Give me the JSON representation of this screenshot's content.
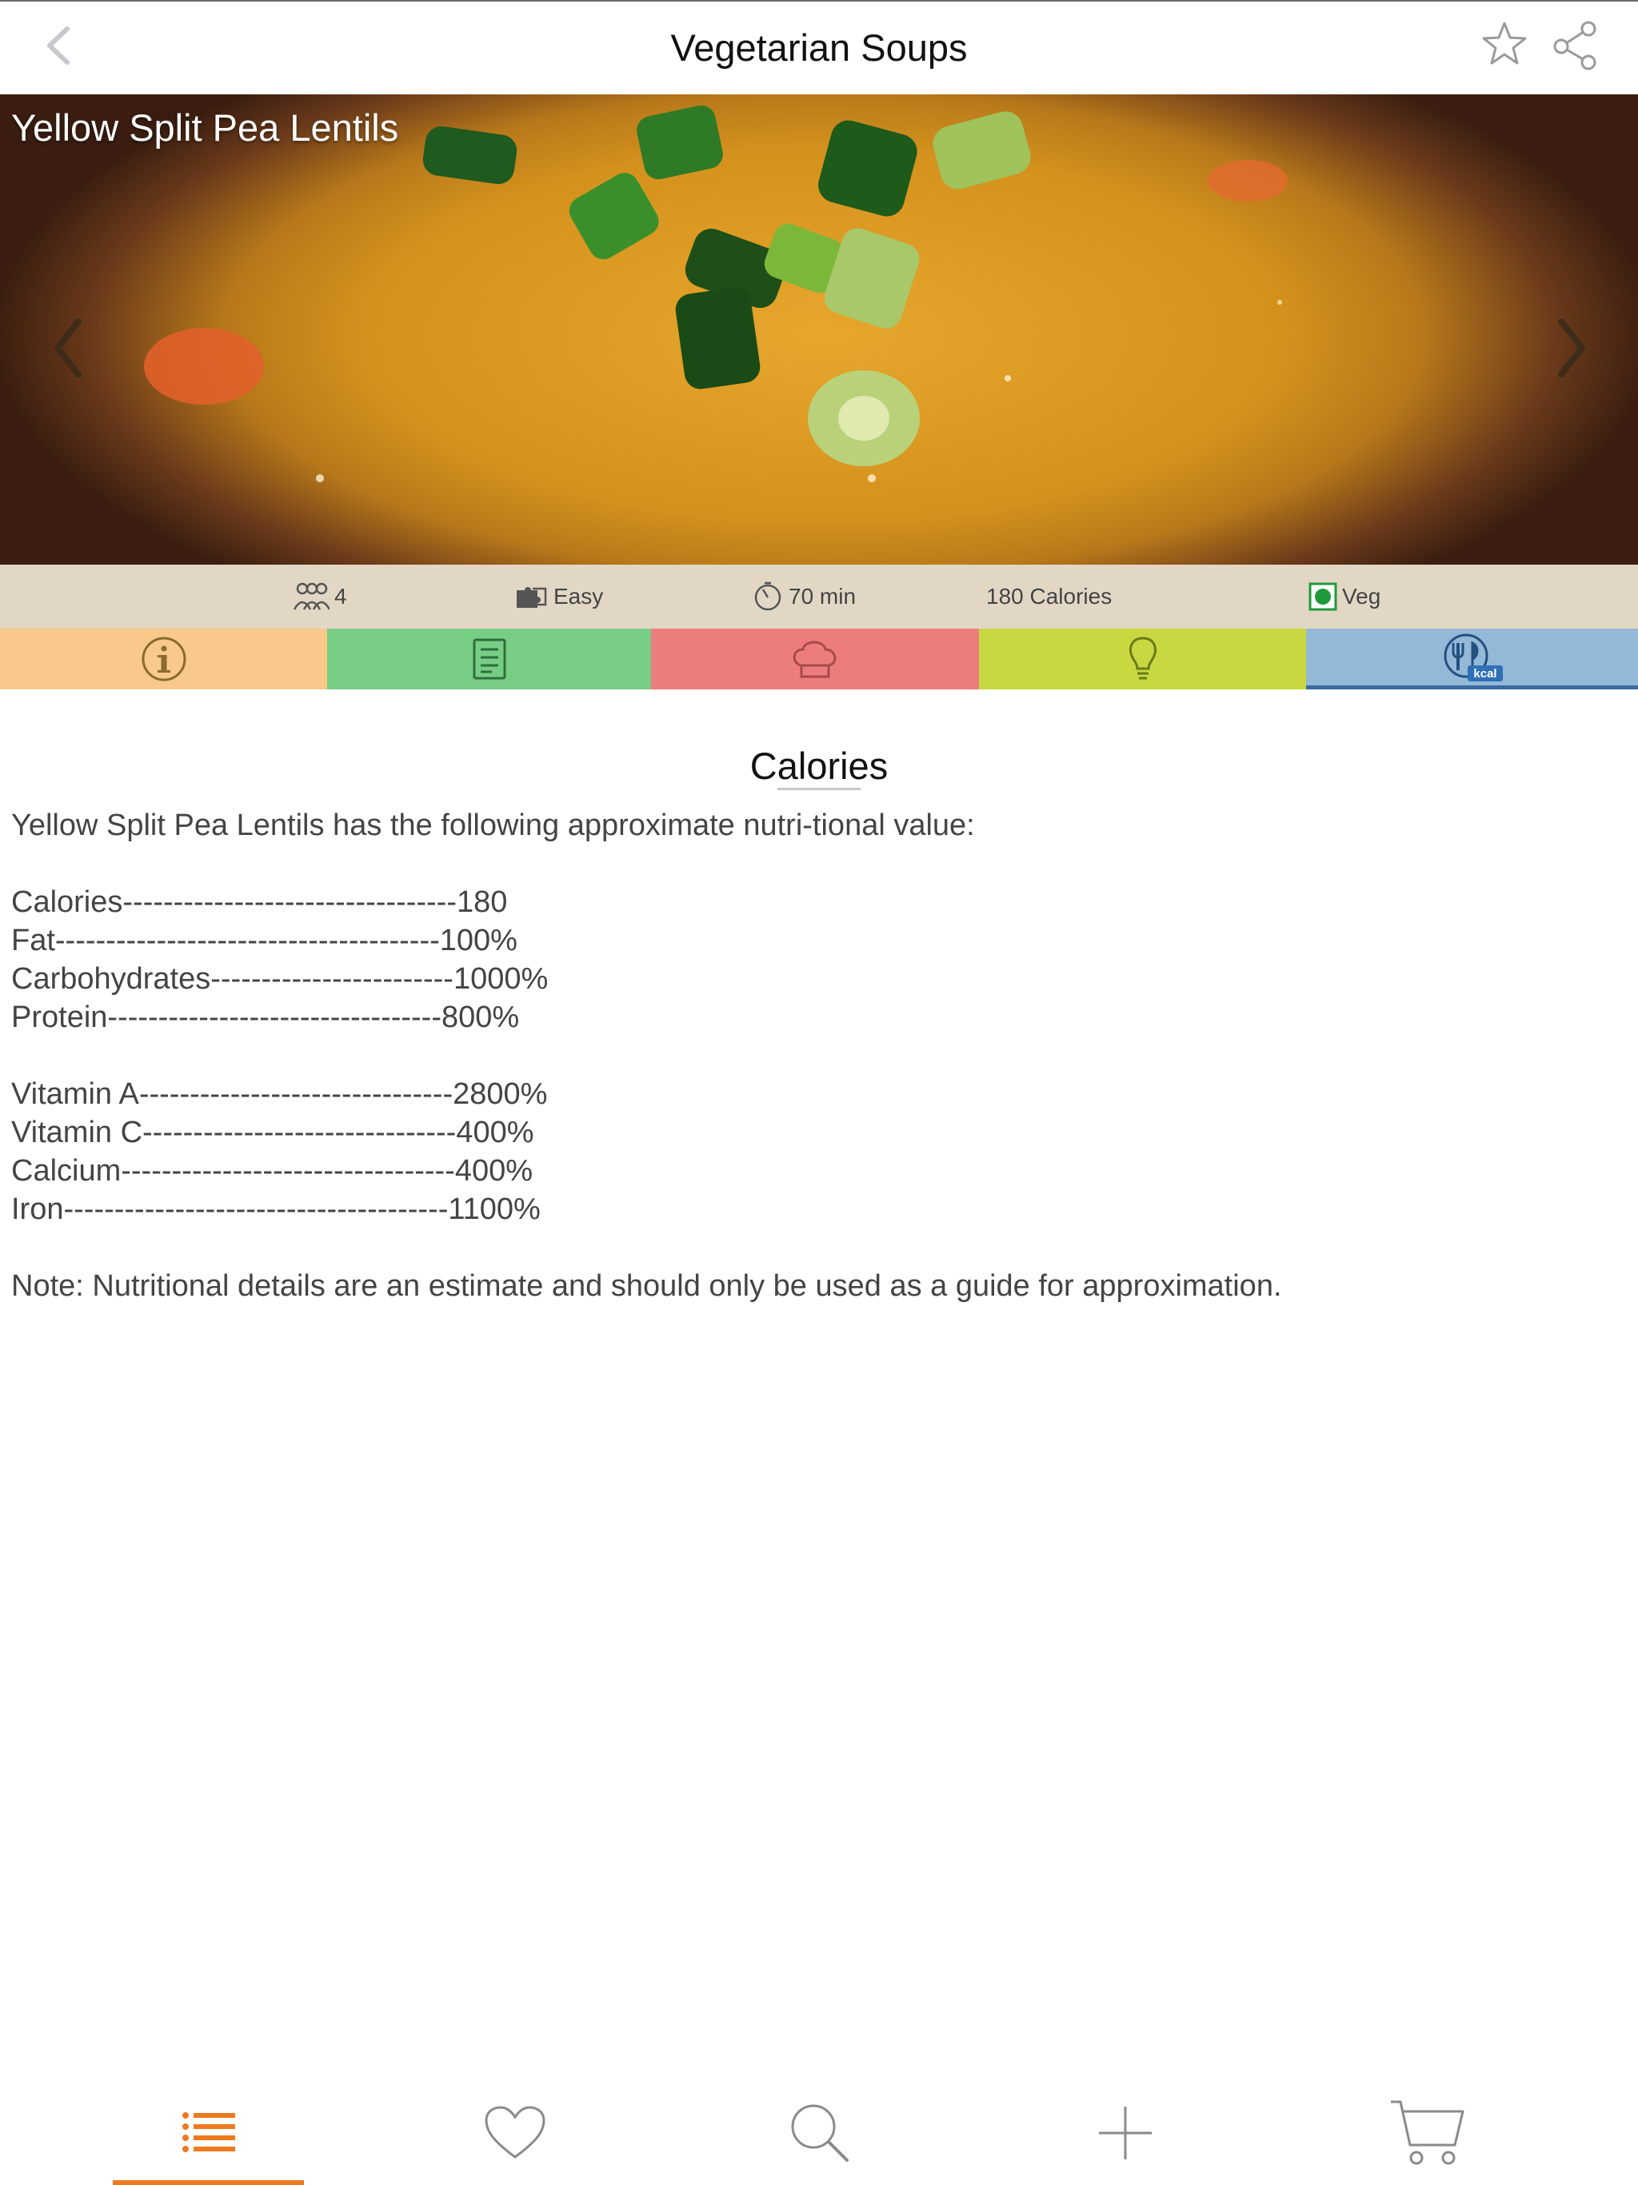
{
  "navbar": {
    "title": "Vegetarian Soups"
  },
  "recipe": {
    "name": "Yellow Split Pea Lentils"
  },
  "info": {
    "servings": "4",
    "difficulty": "Easy",
    "time": "70 min",
    "calories": "180 Calories",
    "diet": "Veg"
  },
  "tabs": [
    "info",
    "ingredients",
    "directions",
    "tips",
    "nutrition"
  ],
  "tab_icons": {
    "nutrition_badge": "kcal"
  },
  "active_tab": "nutrition",
  "content": {
    "title": "Calories",
    "intro": "Yellow Split Pea Lentils has the following approximate nutri-tional value:",
    "rows": [
      "Calories---------------------------------180",
      "Fat--------------------------------------100%",
      "Carbohydrates------------------------1000%",
      "Protein---------------------------------800%",
      "Vitamin A-------------------------------2800%",
      "Vitamin C-------------------------------400%",
      "Calcium---------------------------------400%",
      "Iron--------------------------------------1100%"
    ],
    "note": "Note: Nutritional details are an estimate and should only be used as a guide for approximation."
  },
  "bottom_nav": [
    "list",
    "favorites",
    "search",
    "add",
    "cart"
  ],
  "colors": {
    "accent": "#ee7a1e",
    "tab_info": "#f8c98a",
    "tab_ingredients": "#78cd85",
    "tab_directions": "#ed7d7c",
    "tab_tips": "#c9d840",
    "tab_nutrition": "#93b8d8",
    "veg_green": "#1f9a3a"
  }
}
